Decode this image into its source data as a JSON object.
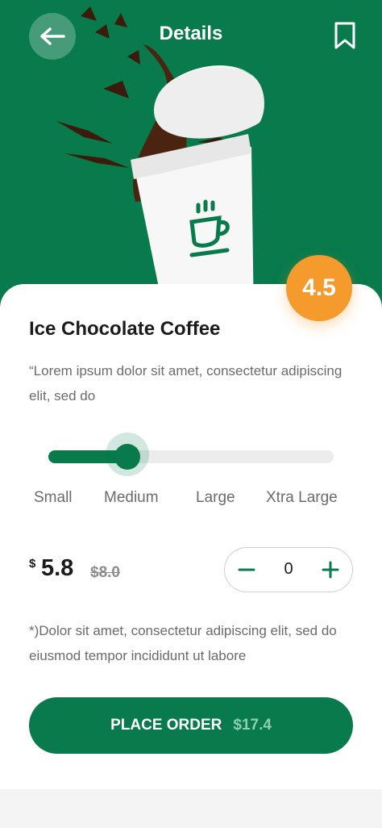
{
  "colors": {
    "brand": "#087a4b",
    "accent": "#f59a2d",
    "background": "#f4f4f4"
  },
  "header": {
    "title": "Details",
    "back_icon": "arrow-left-icon",
    "bookmark_icon": "bookmark-icon"
  },
  "product": {
    "name": "Ice Chocolate Coffee",
    "rating": "4.5",
    "description": "“Lorem ipsum dolor sit amet, consectetur adipiscing elit, sed do",
    "image_icon": "coffee-cup-icon"
  },
  "sizes": {
    "options": [
      "Small",
      "Medium",
      "Large",
      "Xtra Large"
    ],
    "selected": "Medium",
    "selected_index": 1
  },
  "price": {
    "currency": "$",
    "current": "5.8",
    "original": "$8.0"
  },
  "quantity": {
    "value": "0",
    "minus_icon": "minus-icon",
    "plus_icon": "plus-icon"
  },
  "note": "*)Dolor sit amet, consectetur adipiscing elit, sed do eiusmod tempor incididunt ut labore",
  "order": {
    "label": "PLACE ORDER",
    "total": "$17.4"
  }
}
